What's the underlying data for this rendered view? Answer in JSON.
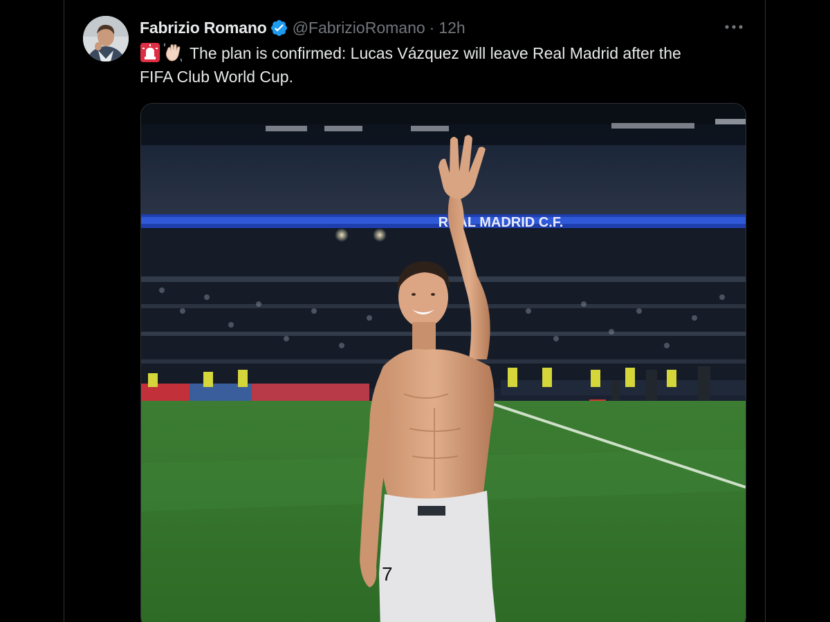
{
  "tweet": {
    "author_name": "Fabrizio Romano",
    "handle": "@FabrizioRomano",
    "separator": "·",
    "time": "12h",
    "text_line1": "The plan is confirmed: Lucas Vázquez will leave Real Madrid after the",
    "text_line2": "FIFA Club World Cup.",
    "emojis": [
      "rotating-light-icon",
      "waving-hand-icon"
    ]
  },
  "media": {
    "banner_text": "REAL MADRID C.F.",
    "shirt_number": "7"
  },
  "colors": {
    "background": "#000000",
    "primary_text": "#e7e9ea",
    "secondary_text": "#71767b",
    "verified_blue": "#1d9bf0",
    "border": "#2f3336"
  }
}
